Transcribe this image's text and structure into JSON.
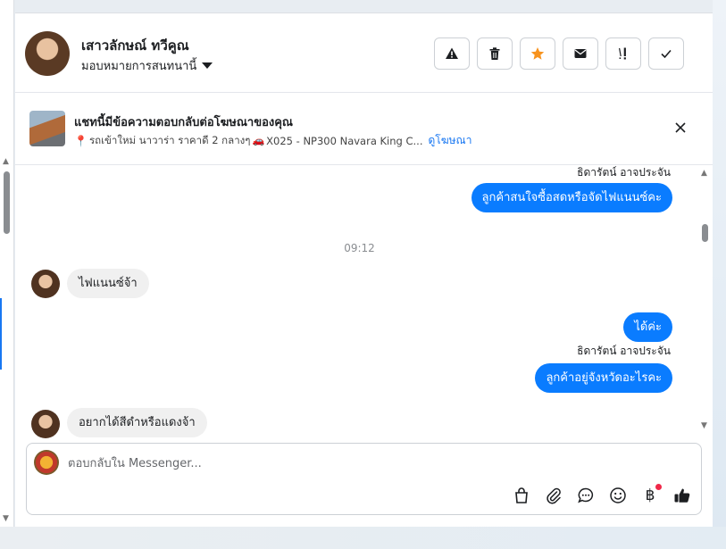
{
  "header": {
    "contact_name": "เสาวลักษณ์ ทวีคูณ",
    "assign_label": "มอบหมายการสนทนานี้",
    "actions": [
      {
        "name": "report-button",
        "icon": "warning-icon"
      },
      {
        "name": "delete-button",
        "icon": "trash-icon"
      },
      {
        "name": "star-button",
        "icon": "star-icon",
        "color": "#f7931e"
      },
      {
        "name": "mark-unread-button",
        "icon": "envelope-icon"
      },
      {
        "name": "follow-up-button",
        "icon": "follow-up-icon"
      },
      {
        "name": "mark-done-button",
        "icon": "check-icon"
      }
    ]
  },
  "ad": {
    "title": "แชทนี้มีข้อความตอบกลับต่อโฆษณาของคุณ",
    "description": "รถเข้าใหม่ นาวาร่า ราคาดี 2 กลางๆ",
    "product": "X025 - NP300 Navara King C...",
    "link_label": "ดูโฆษณา"
  },
  "messages": {
    "sender_1": "ธิดารัตน์ อาจประจัน",
    "out_1": "ลูกค้าสนใจซื้อสดหรือจัดไฟแนนซ์คะ",
    "time": "09:12",
    "in_1": "ไฟแนนซ์จ้า",
    "out_2": "ได้ค่ะ",
    "sender_2": "ธิดารัตน์ อาจประจัน",
    "out_3": "ลูกค้าอยู่จังหวัดอะไรคะ",
    "in_2": "อยากได้สีดำหรือแดงจ้า"
  },
  "composer": {
    "placeholder": "ตอบกลับใน Messenger...",
    "value": ""
  },
  "colors": {
    "accent": "#1877f2",
    "bubble_out": "#0a7cff",
    "bubble_in": "#f0f0f0",
    "star": "#f7931e",
    "notification_dot": "#f02849"
  }
}
